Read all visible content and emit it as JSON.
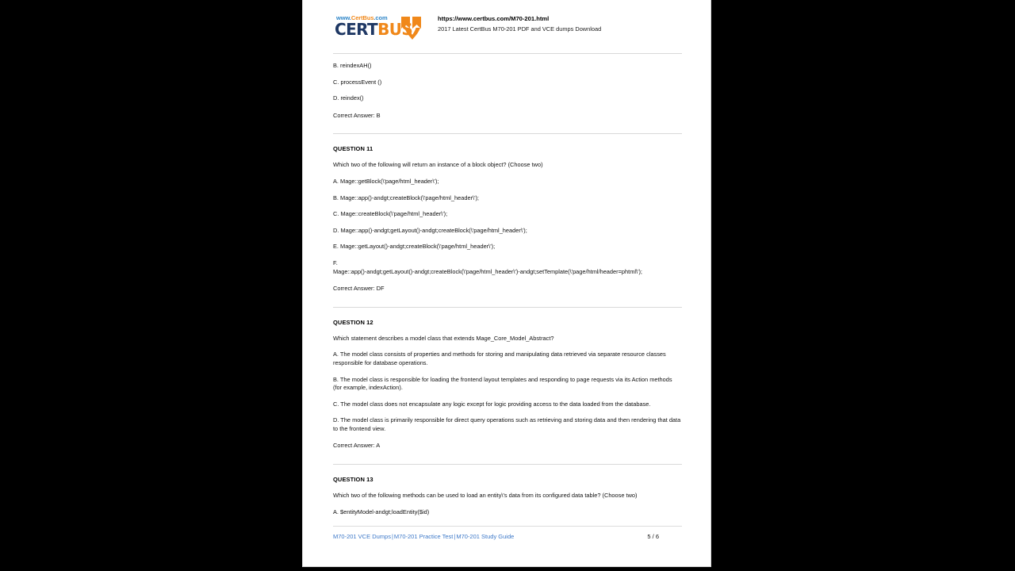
{
  "document": {
    "background_color": "#000000",
    "page_color": "#ffffff",
    "link_color": "#3c78c8"
  },
  "header": {
    "logo": {
      "url_prefix": "www.",
      "url_brand": "CertBus",
      "url_suffix": ".com",
      "word_first": "CERT",
      "word_second": "BUS",
      "mark_name": "certbus-bird-logo",
      "color_blue": "#1f3864",
      "color_orange": "#f0881a"
    },
    "url": "https://www.certbus.com/M70-201.html",
    "subtitle": "2017 Latest CertBus M70-201 PDF and VCE dumps Download"
  },
  "content": {
    "carryover_options": [
      "B. reindexAH()",
      "C. processEvent ()",
      "D. reindex()"
    ],
    "carryover_answer": "Correct Answer: B",
    "questions": [
      {
        "title": "QUESTION 11",
        "stem": "Which two of the following will return an instance of a block object? (Choose two)",
        "options": [
          "A. Mage::getBlock(\\'page/html_header\\');",
          "B. Mage::app()-andgt;createBlock(\\'page/html_header\\');",
          "C. Mage::createBlock(\\'page/html_header\\');",
          "D. Mage::app()-andgt;getLayout()-andgt;createBlock(\\'page/html_header\\');",
          "E. Mage::getLayout()-andgt;createBlock(\\'page/html_header\\');"
        ],
        "option_f_label": "F.",
        "option_f_body": "Mage::app()-andgt;getLayout()-andgt;createBlock(\\'page/html_header\\')-andgt;setTemplate(\\'page/html/header=phtml\\');",
        "answer": "Correct Answer: DF"
      },
      {
        "title": "QUESTION 12",
        "stem": "Which statement describes a model class that extends Mage_Core_Model_Abstract?",
        "options": [
          "A. The model class consists of properties and methods for storing and manipulating data retrieved via separate resource classes responsible for database operations.",
          "B. The model class is responsible for loading the frontend layout templates and responding to page requests via its Action methods (for example, indexAction).",
          "C. The model class does not encapsulate any logic except for logic providing access to the data loaded from the database.",
          "D. The model class is primarily responsible for direct query operations such as retrieving and storing data and then rendering that data to the frontend view."
        ],
        "answer": "Correct Answer: A"
      },
      {
        "title": "QUESTION 13",
        "stem": "Which two of the following methods can be used to load an entity\\'s data from its configured data table? (Choose two)",
        "options": [
          "A. $entityModel-andgt;loadEntity($id)"
        ]
      }
    ]
  },
  "footer": {
    "links": [
      "M70-201 VCE Dumps",
      "M70-201 Practice Test",
      "M70-201 Study Guide"
    ],
    "separator": "|",
    "page_indicator": "5 / 6"
  }
}
